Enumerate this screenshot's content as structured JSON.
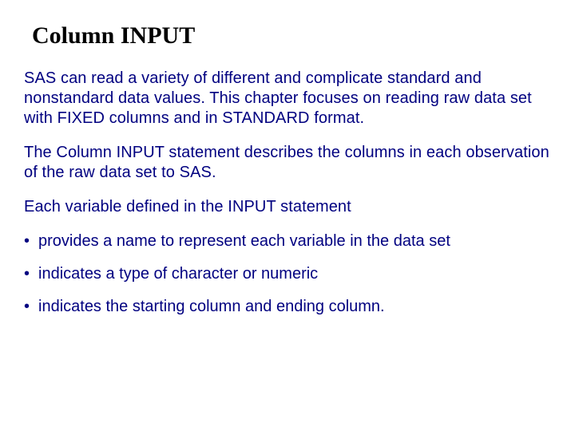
{
  "title": "Column INPUT",
  "paragraphs": [
    "SAS can read a variety of different and complicate standard and nonstandard data values. This chapter focuses on reading raw data set with FIXED columns and in STANDARD format.",
    "The Column INPUT statement describes the columns in each observation of the raw data set to SAS.",
    "Each variable defined in the INPUT statement"
  ],
  "bullets": [
    "provides a name to represent each variable in the data set",
    "indicates a type of character or numeric",
    "indicates the starting column and ending column."
  ]
}
